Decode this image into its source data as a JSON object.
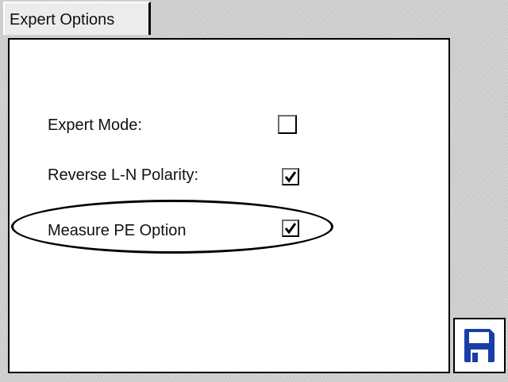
{
  "tab": {
    "label": "Expert Options"
  },
  "options": [
    {
      "label": "Expert Mode:",
      "checked": false
    },
    {
      "label": "Reverse L-N Polarity:",
      "checked": true
    },
    {
      "label": "Measure PE Option",
      "checked": true
    }
  ],
  "toolbar": {
    "save_icon": "floppy-disk-icon"
  },
  "colors": {
    "save_icon": "#1a3ea8",
    "highlight": "#000000"
  }
}
